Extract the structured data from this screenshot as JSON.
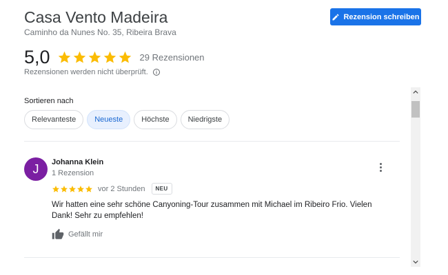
{
  "place": {
    "name": "Casa Vento Madeira",
    "address": "Caminho da Nunes No. 35, Ribeira Brava"
  },
  "write_review": {
    "label": "Rezension schreiben",
    "icon": "pencil-icon"
  },
  "summary": {
    "rating": "5,0",
    "stars": 5,
    "review_count": "29 Rezensionen",
    "not_verified": "Rezensionen werden nicht überprüft.",
    "info_icon": "info-icon"
  },
  "sort": {
    "label": "Sortieren nach",
    "options": [
      "Relevanteste",
      "Neueste",
      "Höchste",
      "Niedrigste"
    ],
    "selected": "Neueste"
  },
  "review": {
    "avatar_letter": "J",
    "avatar_color": "#7b1fa2",
    "name": "Johanna Klein",
    "meta": "1 Rezension",
    "stars": 5,
    "time": "vor 2 Stunden",
    "badge": "NEU",
    "text": "Wir hatten eine sehr schöne Canyoning-Tour zusammen mit Michael im Ribeiro Frio. Vielen Dank! Sehr zu empfehlen!",
    "like_label": "Gefällt mir"
  },
  "colors": {
    "accent": "#1a73e8",
    "star": "#fbbc04",
    "chip_selected_bg": "#e8f0fe"
  }
}
